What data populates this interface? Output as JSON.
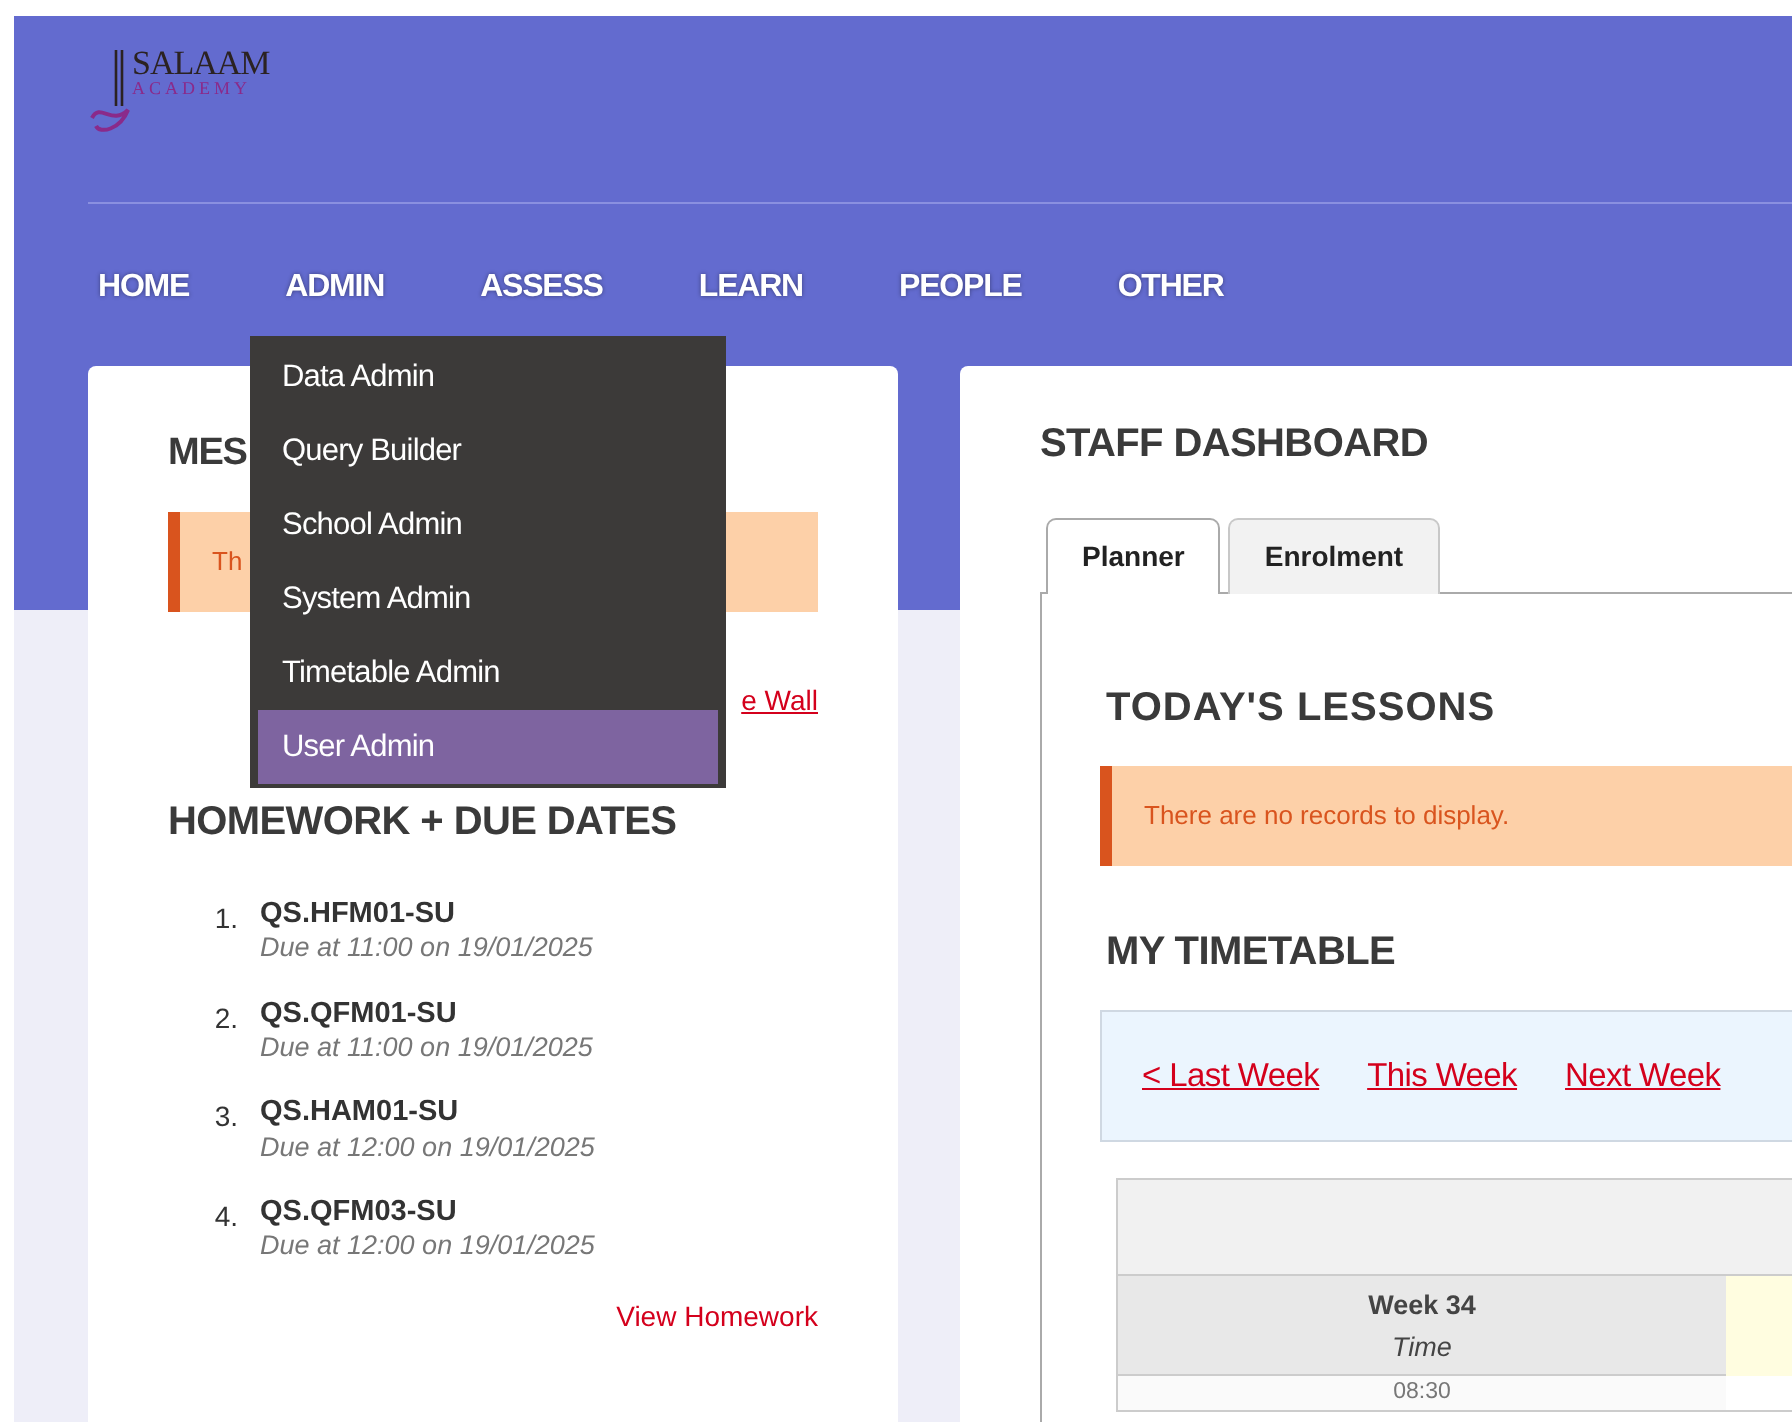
{
  "logo": {
    "name": "SALAAM",
    "subtitle": "ACADEMY"
  },
  "nav": [
    {
      "label": "HOME"
    },
    {
      "label": "ADMIN",
      "menu": [
        {
          "label": "Data Admin",
          "selected": false
        },
        {
          "label": "Query Builder",
          "selected": false
        },
        {
          "label": "School Admin",
          "selected": false
        },
        {
          "label": "System Admin",
          "selected": false
        },
        {
          "label": "Timetable Admin",
          "selected": false
        },
        {
          "label": "User Admin",
          "selected": true
        }
      ]
    },
    {
      "label": "ASSESS"
    },
    {
      "label": "LEARN"
    },
    {
      "label": "PEOPLE"
    },
    {
      "label": "OTHER"
    }
  ],
  "messages": {
    "title": "MES",
    "alert": "Th",
    "link": "e Wall"
  },
  "homework": {
    "title": "HOMEWORK + DUE DATES",
    "items": [
      {
        "number": "1.",
        "code": "QS.HFM01-SU",
        "due": "Due at 11:00 on 19/01/2025"
      },
      {
        "number": "2.",
        "code": "QS.QFM01-SU",
        "due": "Due at 11:00 on 19/01/2025"
      },
      {
        "number": "3.",
        "code": "QS.HAM01-SU",
        "due": "Due at 12:00 on 19/01/2025"
      },
      {
        "number": "4.",
        "code": "QS.QFM03-SU",
        "due": "Due at 12:00 on 19/01/2025"
      }
    ],
    "link": "View Homework"
  },
  "dashboard": {
    "title": "STAFF DASHBOARD",
    "tabs": [
      {
        "label": "Planner",
        "selected": true
      },
      {
        "label": "Enrolment",
        "selected": false
      }
    ],
    "lessons_title": "TODAY'S LESSONS",
    "lessons_alert": "There are no records to display.",
    "timetable_title": "MY TIMETABLE",
    "week_links": [
      "< Last Week",
      "This Week",
      "Next Week"
    ],
    "timetable": {
      "week": "Week 34",
      "time_label": "Time",
      "times": [
        "08:30"
      ]
    }
  }
}
